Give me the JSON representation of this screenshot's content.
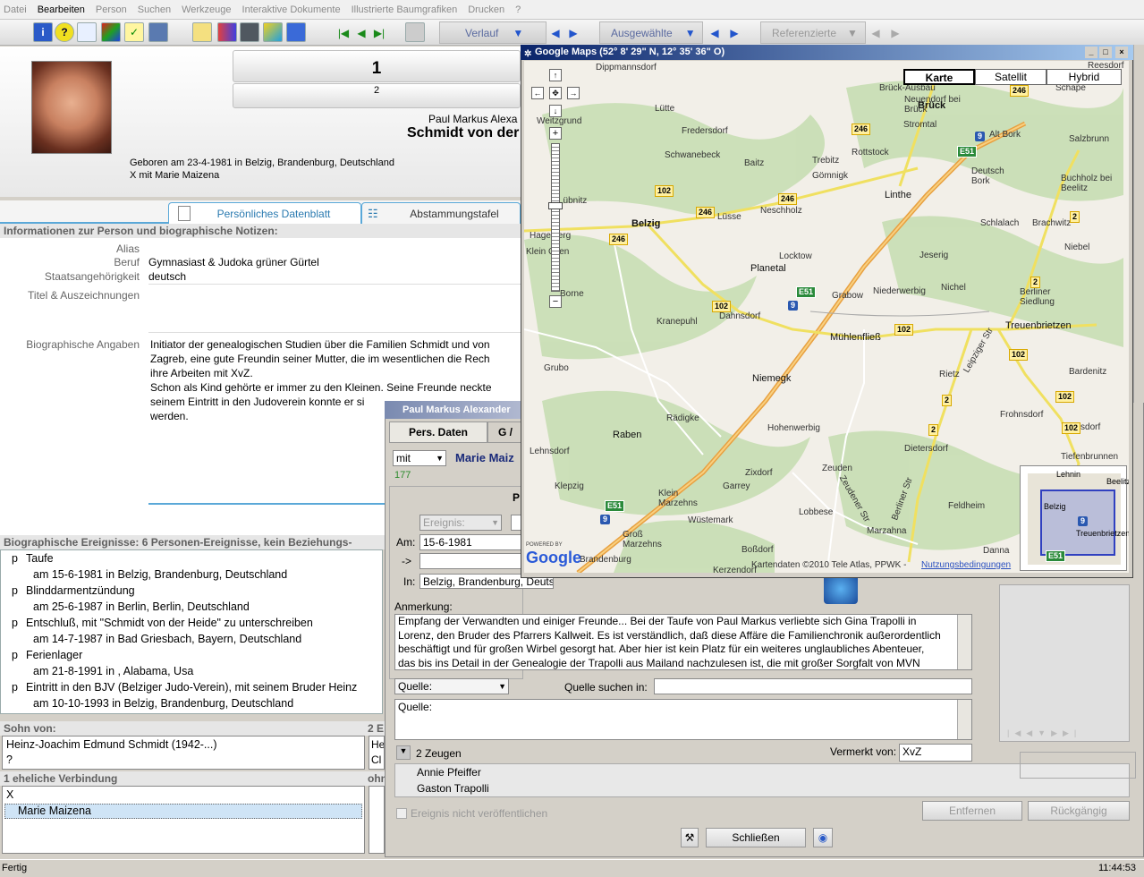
{
  "menu": [
    "Datei",
    "Bearbeiten",
    "Person",
    "Suchen",
    "Werkzeuge",
    "Interaktive Dokumente",
    "Illustrierte Baumgrafiken",
    "Drucken",
    "?"
  ],
  "toolbar": {
    "verlauf": "Verlauf",
    "ausgewaehlte": "Ausgewählte",
    "referenzierte": "Referenzierte"
  },
  "header": {
    "number_main": "1",
    "number_sub": "2",
    "first_names": "Paul Markus Alexa",
    "surname": "Schmidt von der",
    "born": "Geboren am 23-4-1981 in Belzig, Brandenburg, Deutschland",
    "partner": "X  mit Marie Maizena"
  },
  "tabs": {
    "personal": "Persönliches Datenblatt",
    "ancestry": "Abstammungstafel"
  },
  "info": {
    "section_title": "Informationen zur Person und biographische Notizen:",
    "alias_label": "Alias",
    "beruf_label": "Beruf",
    "beruf_value": "Gymnasiast & Judoka grüner Gürtel",
    "staat_label": "Staatsangehörigkeit",
    "staat_value": "deutsch",
    "titel_label": "Titel & Auszeichnungen",
    "bio_label": "Biographische Angaben",
    "bio_lines": [
      "Initiator der genealogischen Studien über die Familien Schmidt und von",
      "Zagreb, eine gute Freundin seiner Mutter, die im wesentlichen die Rech",
      "ihre Arbeiten mit XvZ.",
      "Schon als Kind gehörte er immer zu den Kleinen. Seine Freunde neckte",
      "seinem Eintritt in den Judoverein konnte er si",
      "werden."
    ]
  },
  "events": {
    "title": "Biographische Ereignisse: 6 Personen-Ereignisse, kein Beziehungs-Ereignis",
    "items": [
      {
        "p": "p",
        "name": "Taufe",
        "detail": "am 15-6-1981 in Belzig, Brandenburg, Deutschland"
      },
      {
        "p": "p",
        "name": "Blinddarmentzündung",
        "detail": "am 25-6-1987 in Berlin, Berlin, Deutschland"
      },
      {
        "p": "p",
        "name": "Entschluß, mit \"Schmidt von der Heide\" zu unterschreiben",
        "detail": "am 14-7-1987 in Bad Griesbach, Bayern, Deutschland"
      },
      {
        "p": "p",
        "name": "Ferienlager",
        "detail": "am 21-8-1991 in , Alabama, Usa"
      },
      {
        "p": "p",
        "name": "Eintritt in den BJV (Belziger Judo-Verein), mit seinem Bruder Heinz",
        "detail": "am 10-10-1993 in Belzig, Brandenburg, Deutschland"
      }
    ]
  },
  "family": {
    "sohn_label": "Sohn von:",
    "father": "Heinz-Joachim Edmund Schmidt (1942-...)",
    "mother": "?",
    "side_label": "2 E",
    "side_a": "He",
    "side_b": "Cl",
    "union_label": "1 eheliche Verbindung",
    "union_x": "X",
    "spouse": "Marie Maizena",
    "ohne_label": "ohn"
  },
  "dialog": {
    "title": "Paul Markus Alexander",
    "tab_pers": "Pers. Daten",
    "tab_g": "G /",
    "mit": "mit",
    "partner": "Marie Maiz",
    "id": "177",
    "p_letter": "P",
    "ereignis": "Ereignis:",
    "am_label": "Am:",
    "am_value": "15-6-1981",
    "arrow_label": "->",
    "in_label": "In:",
    "in_value": "Belzig, Brandenburg, Deutschland",
    "anmerkung_label": "Anmerkung:",
    "anmerkung_lines": [
      "Empfang der Verwandten und einiger Freunde... Bei der Taufe von Paul Markus verliebte sich Gina Trapolli in",
      "Lorenz, den Bruder des Pfarrers Kallweit. Es ist verständlich, daß diese Affäre die Familienchronik außerordentlich",
      "beschäftigt und für großen Wirbel gesorgt hat. Aber hier ist kein Platz für ein weiteres unglaubliches Abenteuer,",
      "das bis ins Detail in der Genealogie der Trapolli aus Mailand nachzulesen ist, die mit großer Sorgfalt von MVN"
    ],
    "quelle_select": "Quelle:",
    "quelle_suchen": "Quelle suchen in:",
    "quelle_text": "Quelle:",
    "zeugen": "2 Zeugen",
    "vermerkt_label": "Vermerkt von:",
    "vermerkt_value": "XvZ",
    "witnesses": [
      "Annie Pfeiffer",
      "Gaston Trapolli"
    ],
    "unpublished": "Ereignis nicht veröffentlichen",
    "btn_entfernen": "Entfernen",
    "btn_rueck": "Rückgängig",
    "btn_close": "Schließen"
  },
  "map": {
    "title": "Google Maps (52° 8' 29\" N, 12° 35' 36\" O)",
    "buttons": [
      "Karte",
      "Satellit",
      "Hybrid"
    ],
    "copyright": "Kartendaten ©2010 Tele Atlas, PPWK -",
    "terms": "Nutzungsbedingungen",
    "powered": "POWERED BY",
    "google": "Google",
    "towns_big": [
      "Brück",
      "Belzig",
      "Linthe",
      "Planetal",
      "Niemegk",
      "Mühlenfließ",
      "Treuenbrietzen",
      "Raben"
    ],
    "towns_small": [
      "Dippmannsdorf",
      "Lütte",
      "Fredersdorf",
      "Schwanebeck",
      "Baitz",
      "Trebitz",
      "Rottstock",
      "Gömnigk",
      "Lüsse",
      "Neschholz",
      "Locktow",
      "Dahnsdorf",
      "Kranepuhl",
      "Grabow",
      "Niederwerbig",
      "Nichel",
      "Rietz",
      "Grubo",
      "Rädigke",
      "Hohenwerbig",
      "Zixdorf",
      "Garrey",
      "Zeuden",
      "Lobbese",
      "Marzahna",
      "Dietersdorf",
      "Frohnsdorf",
      "Klausdorf",
      "Tiefenbrunnen",
      "Feldheim",
      "Danna",
      "Bardenitz",
      "Lehnsdorf",
      "Klepzig",
      "Klein Marzehns",
      "Wüstemark",
      "Groß Marzehns",
      "Boßdorf",
      "Brandenburg",
      "Kerzendorf",
      "Alt Bork",
      "Deutsch Bork",
      "Salzbrunn",
      "Buchholz bei Beelitz",
      "Schlalach",
      "Brachwitz",
      "Niebel",
      "Jeserig",
      "Berliner Siedlung",
      "Stromtal",
      "Neuendorf bei Brück",
      "Brück-Ausbau",
      "Schäpe",
      "Reesdorf",
      "Weitzgrund",
      "Hagelberg",
      "Klein Glien",
      "Borne",
      "Lübnitz"
    ],
    "shields": [
      "246",
      "246",
      "246",
      "246",
      "246",
      "102",
      "102",
      "102",
      "102",
      "102",
      "102",
      "2",
      "2",
      "2",
      "2"
    ],
    "eshields": [
      "E51",
      "E51",
      "E51"
    ],
    "bshields": [
      "9",
      "9",
      "9"
    ],
    "roads": [
      "Leipziger Str",
      "Zeudener Str",
      "Berliner Str"
    ],
    "mini": {
      "labels": [
        "Lehnin",
        "Belzig",
        "Treuenbrietzen",
        "Beelitz"
      ],
      "road": "9",
      "e": "E51"
    }
  },
  "status": {
    "text": "Fertig",
    "time": "11:44:53"
  }
}
